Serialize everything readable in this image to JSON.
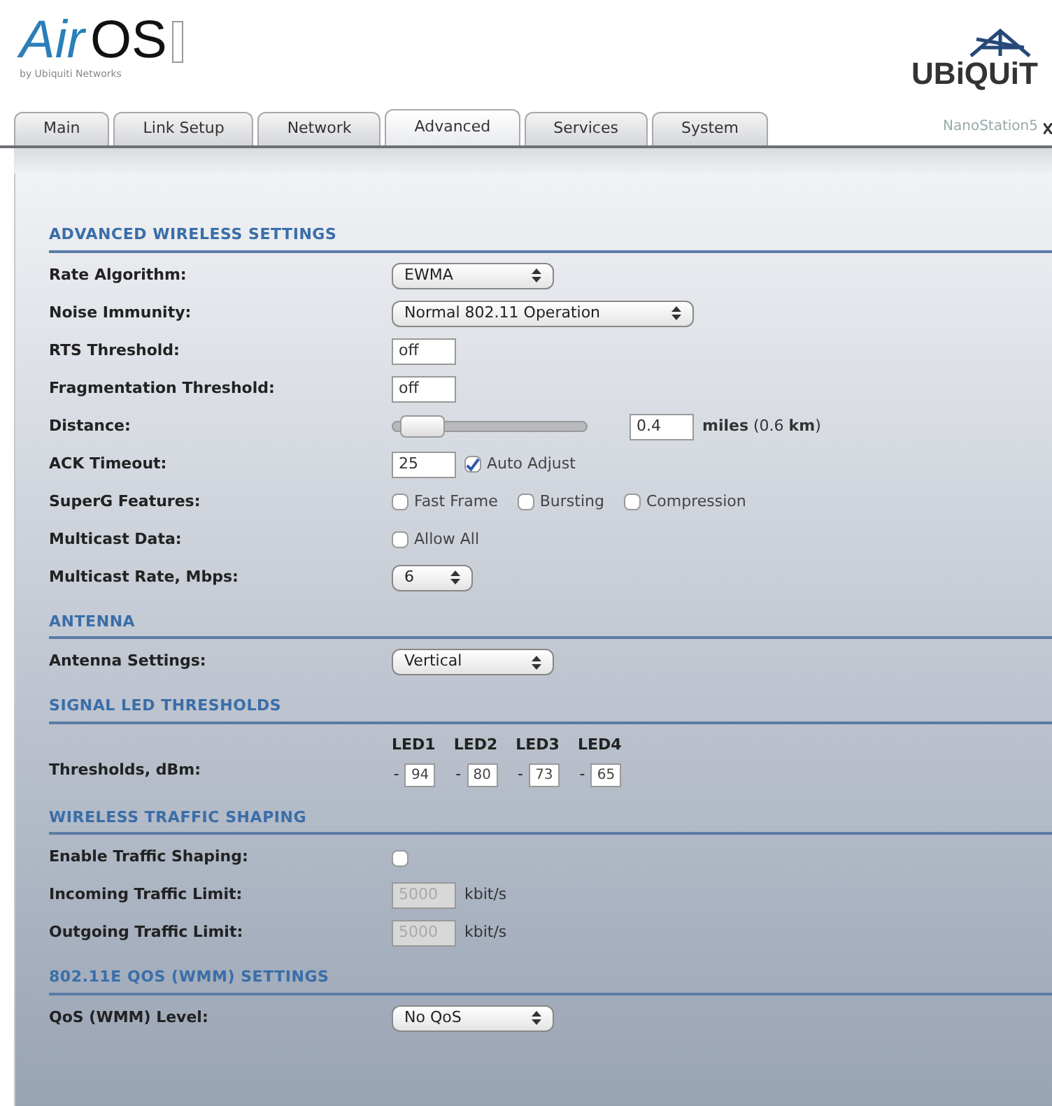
{
  "logo": {
    "air": "Air",
    "os": "OS",
    "byline": "by Ubiquiti Networks"
  },
  "brand": {
    "name": "UBiQUiT"
  },
  "tabs": [
    {
      "label": "Main",
      "selected": false
    },
    {
      "label": "Link Setup",
      "selected": false
    },
    {
      "label": "Network",
      "selected": false
    },
    {
      "label": "Advanced",
      "selected": true
    },
    {
      "label": "Services",
      "selected": false
    },
    {
      "label": "System",
      "selected": false
    }
  ],
  "device": {
    "name": "NanoStation5"
  },
  "sections": [
    {
      "title": "ADVANCED WIRELESS SETTINGS",
      "rows": [
        {
          "label": "Rate Algorithm:",
          "controls": [
            {
              "kind": "select",
              "value": "EWMA"
            }
          ]
        },
        {
          "label": "Noise Immunity:",
          "controls": [
            {
              "kind": "select",
              "value": "Normal 802.11 Operation"
            }
          ]
        },
        {
          "label": "RTS Threshold:",
          "controls": [
            {
              "kind": "text",
              "value": "off",
              "disabled": false
            }
          ]
        },
        {
          "label": "Fragmentation Threshold:",
          "controls": [
            {
              "kind": "text",
              "value": "off",
              "disabled": false
            }
          ]
        },
        {
          "label": "Distance:",
          "controls": [
            {
              "kind": "slider",
              "level": 0.05
            },
            {
              "kind": "text",
              "value": "0.4",
              "disabled": false
            },
            {
              "kind": "unit",
              "text": "**miles** (0.6 **km**)"
            }
          ]
        },
        {
          "label": "ACK Timeout:",
          "controls": [
            {
              "kind": "text",
              "value": "25",
              "disabled": false
            },
            {
              "kind": "checkbox",
              "label": "Auto Adjust",
              "checked": true
            }
          ]
        },
        {
          "label": "SuperG Features:",
          "controls": [
            {
              "kind": "checkbox",
              "label": "Fast Frame",
              "checked": false
            },
            {
              "kind": "checkbox",
              "label": "Bursting",
              "checked": false
            },
            {
              "kind": "checkbox",
              "label": "Compression",
              "checked": false
            }
          ]
        },
        {
          "label": "Multicast Data:",
          "controls": [
            {
              "kind": "checkbox",
              "label": "Allow All",
              "checked": false
            }
          ]
        },
        {
          "label": "Multicast Rate, Mbps:",
          "controls": [
            {
              "kind": "select",
              "value": "6"
            }
          ]
        }
      ]
    },
    {
      "title": "ANTENNA",
      "rows": [
        {
          "label": "Antenna Settings:",
          "controls": [
            {
              "kind": "select",
              "value": "Vertical"
            }
          ]
        }
      ]
    },
    {
      "title": "SIGNAL LED THRESHOLDS",
      "rows": [
        {
          "label": "Thresholds, dBm:",
          "controls": [
            {
              "kind": "led",
              "header": "LED1",
              "sign": "-",
              "value": "94"
            },
            {
              "kind": "led",
              "header": "LED2",
              "sign": "-",
              "value": "80"
            },
            {
              "kind": "led",
              "header": "LED3",
              "sign": "-",
              "value": "73"
            },
            {
              "kind": "led",
              "header": "LED4",
              "sign": "-",
              "value": "65"
            }
          ]
        }
      ]
    },
    {
      "title": "WIRELESS TRAFFIC SHAPING",
      "rows": [
        {
          "label": "Enable Traffic Shaping:",
          "controls": [
            {
              "kind": "checkbox",
              "checked": false
            }
          ]
        },
        {
          "label": "Incoming Traffic Limit:",
          "controls": [
            {
              "kind": "text",
              "value": "5000",
              "disabled": true
            },
            {
              "kind": "unit",
              "text": "kbit/s"
            }
          ]
        },
        {
          "label": "Outgoing Traffic Limit:",
          "controls": [
            {
              "kind": "text",
              "value": "5000",
              "disabled": true
            },
            {
              "kind": "unit",
              "text": "kbit/s"
            }
          ]
        }
      ]
    },
    {
      "title": "802.11E QOS (WMM) SETTINGS",
      "rows": [
        {
          "label": "QoS (WMM) Level:",
          "controls": [
            {
              "kind": "select",
              "value": "No QoS"
            }
          ]
        }
      ]
    }
  ]
}
